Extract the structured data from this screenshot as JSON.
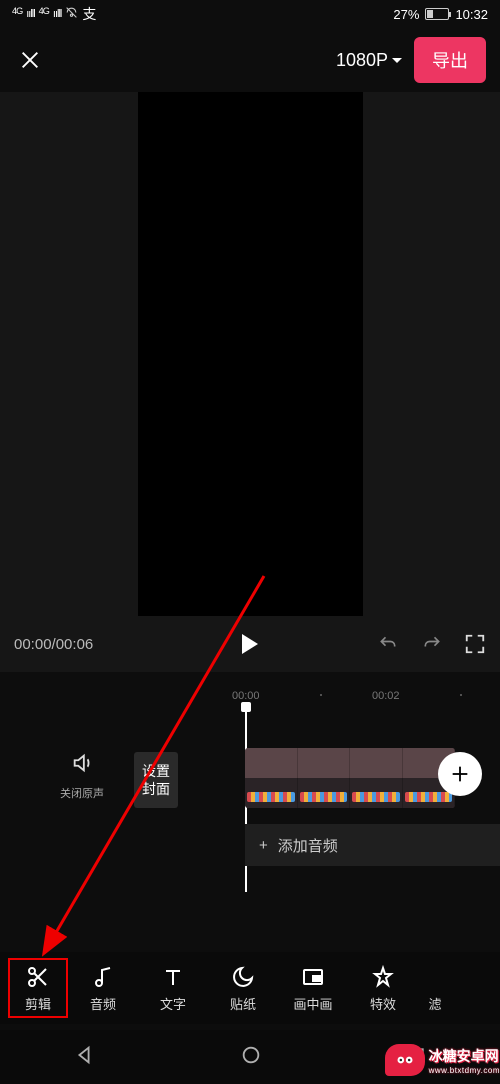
{
  "status": {
    "network_badge": "4G",
    "signal": "ıılll",
    "icons": [
      "mute",
      "alipay"
    ],
    "battery_pct": "27%",
    "time": "10:32"
  },
  "topbar": {
    "resolution": "1080P",
    "export": "导出"
  },
  "playback": {
    "current": "00:00",
    "total": "00:06"
  },
  "ruler": {
    "t0": "00:00",
    "t1": "00:02"
  },
  "tracks": {
    "mute_label": "关闭原声",
    "cover_line1": "设置",
    "cover_line2": "封面",
    "add_audio_prefix": "+",
    "add_audio": "添加音频"
  },
  "tools": [
    {
      "key": "edit",
      "label": "剪辑",
      "icon": "scissors-icon"
    },
    {
      "key": "audio",
      "label": "音频",
      "icon": "music-note-icon"
    },
    {
      "key": "text",
      "label": "文字",
      "icon": "text-t-icon"
    },
    {
      "key": "sticker",
      "label": "贴纸",
      "icon": "moon-icon"
    },
    {
      "key": "pip",
      "label": "画中画",
      "icon": "pip-icon"
    },
    {
      "key": "effect",
      "label": "特效",
      "icon": "star-icon"
    },
    {
      "key": "filter",
      "label": "滤",
      "icon": ""
    }
  ],
  "watermark": {
    "main": "冰糖安卓网",
    "sub": "www.btxtdmy.com"
  }
}
